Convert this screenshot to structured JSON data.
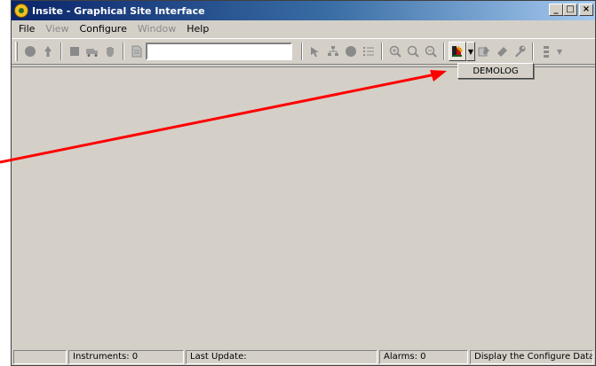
{
  "window": {
    "title": "Insite - Graphical Site Interface",
    "controls": [
      "minimize",
      "maximize",
      "close"
    ]
  },
  "menu": [
    {
      "label": "File",
      "enabled": true
    },
    {
      "label": "View",
      "enabled": false
    },
    {
      "label": "Configure",
      "enabled": true
    },
    {
      "label": "Window",
      "enabled": false
    },
    {
      "label": "Help",
      "enabled": true
    }
  ],
  "toolbar": {
    "search_value": "",
    "icons": [
      "circle-icon",
      "up-arrow-icon",
      "stop-icon",
      "truck-icon",
      "hand-icon",
      "doc-icon",
      "pointer-icon",
      "tree-icon",
      "circle-icon",
      "list-icon",
      "zoom-in-icon",
      "zoom-icon",
      "zoom-out-icon",
      "configure-database-icon",
      "pen-icon",
      "marker-icon",
      "wrench-icon",
      "list-icon"
    ]
  },
  "dropdown": {
    "items": [
      "DEMOLOG"
    ]
  },
  "statusbar": {
    "instruments": "Instruments: 0",
    "last_update": "Last Update:",
    "alarms": "Alarms: 0",
    "hint": "Display the Configure Datab"
  },
  "annotation": {
    "color": "#ff0000"
  }
}
